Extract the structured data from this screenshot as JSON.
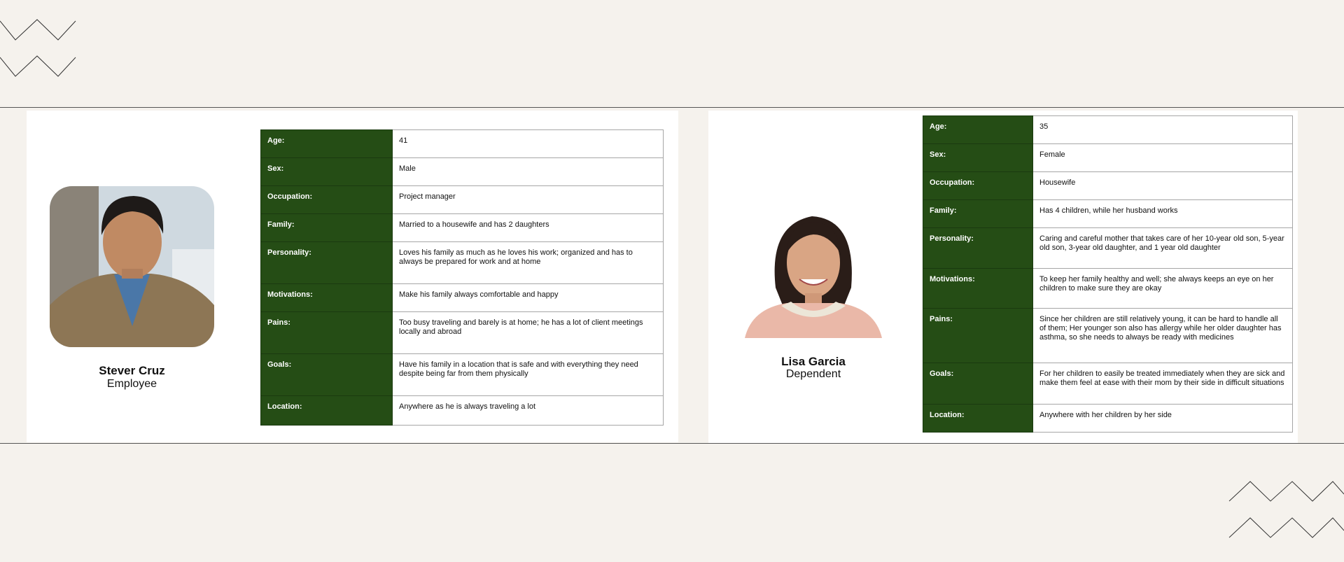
{
  "colors": {
    "background": "#f5f2ed",
    "card": "#ffffff",
    "label_cell": "#254d15",
    "border": "#a6a6a6"
  },
  "personas": [
    {
      "name": "Stever Cruz",
      "role": "Employee",
      "photo": "man-in-brown-blazer-photo",
      "rows": [
        {
          "label": "Age:",
          "value": "41"
        },
        {
          "label": "Sex:",
          "value": "Male"
        },
        {
          "label": "Occupation:",
          "value": "Project manager"
        },
        {
          "label": "Family:",
          "value": "Married to a housewife and has 2 daughters"
        },
        {
          "label": "Personality:",
          "value": "Loves his family as much as he loves his work; organized and has to always be prepared for work and at home"
        },
        {
          "label": "Motivations:",
          "value": "Make his family always comfortable and happy"
        },
        {
          "label": "Pains:",
          "value": "Too busy traveling and barely is at home; he has a lot of client meetings locally and abroad"
        },
        {
          "label": "Goals:",
          "value": "Have his family in a location that is safe and with everything they need despite being far from them physically"
        },
        {
          "label": "Location:",
          "value": "Anywhere as he is always traveling a lot"
        }
      ]
    },
    {
      "name": "Lisa Garcia",
      "role": "Dependent",
      "photo": "woman-in-pink-blouse-photo",
      "rows": [
        {
          "label": "Age:",
          "value": "35"
        },
        {
          "label": "Sex:",
          "value": "Female"
        },
        {
          "label": "Occupation:",
          "value": "Housewife"
        },
        {
          "label": "Family:",
          "value": "Has 4 children, while her husband works"
        },
        {
          "label": "Personality:",
          "value": "Caring and careful mother that takes care of her 10-year old son, 5-year old son, 3-year old daughter, and 1 year old daughter"
        },
        {
          "label": "Motivations:",
          "value": "To keep her family healthy and well; she always keeps an eye on her children to make sure they are okay"
        },
        {
          "label": "Pains:",
          "value": "Since her children are still relatively young, it can be hard to handle all of them; Her younger son also has allergy while her older daughter has asthma, so she needs to always be ready with medicines"
        },
        {
          "label": "Goals:",
          "value": "For her children to easily be treated immediately when they are sick and make them feel at ease with their mom by their side in difficult situations"
        },
        {
          "label": "Location:",
          "value": "Anywhere with her children by her side"
        }
      ]
    }
  ]
}
